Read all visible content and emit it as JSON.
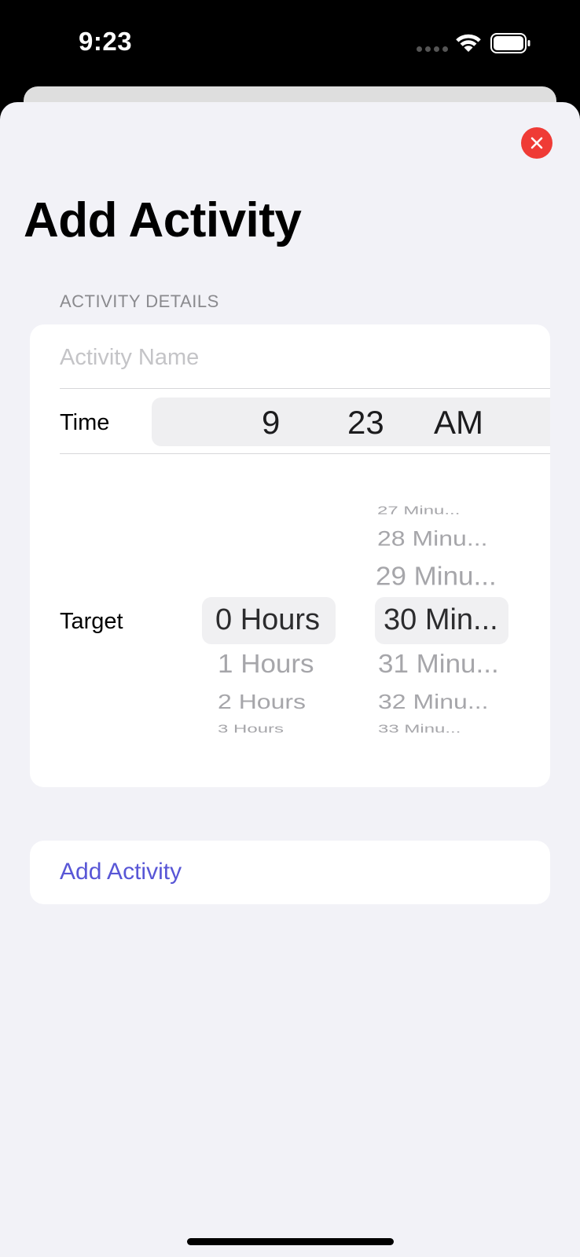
{
  "status_bar": {
    "time": "9:23",
    "signal_icon": "cellular-dots-icon",
    "wifi_icon": "wifi-icon",
    "battery_icon": "battery-icon"
  },
  "sheet": {
    "close_icon": "close-icon",
    "title": "Add Activity"
  },
  "form": {
    "section_header": "ACTIVITY DETAILS",
    "name_placeholder": "Activity Name",
    "name_value": "",
    "time_label": "Time",
    "time": {
      "hour": "9",
      "minute": "23",
      "period": "AM"
    },
    "target_label": "Target",
    "hours_wheel": {
      "selected": "0 Hours",
      "below": [
        "1 Hours",
        "2 Hours",
        "3 Hours"
      ]
    },
    "minutes_wheel": {
      "above": [
        "27 Minu...",
        "28 Minu...",
        "29 Minu..."
      ],
      "selected": "30 Min...",
      "below": [
        "31 Minu...",
        "32 Minu...",
        "33 Minu..."
      ]
    }
  },
  "actions": {
    "add_label": "Add Activity"
  },
  "colors": {
    "accent": "#5856d6",
    "close_red": "#ef3b36",
    "background": "#f2f2f7"
  }
}
